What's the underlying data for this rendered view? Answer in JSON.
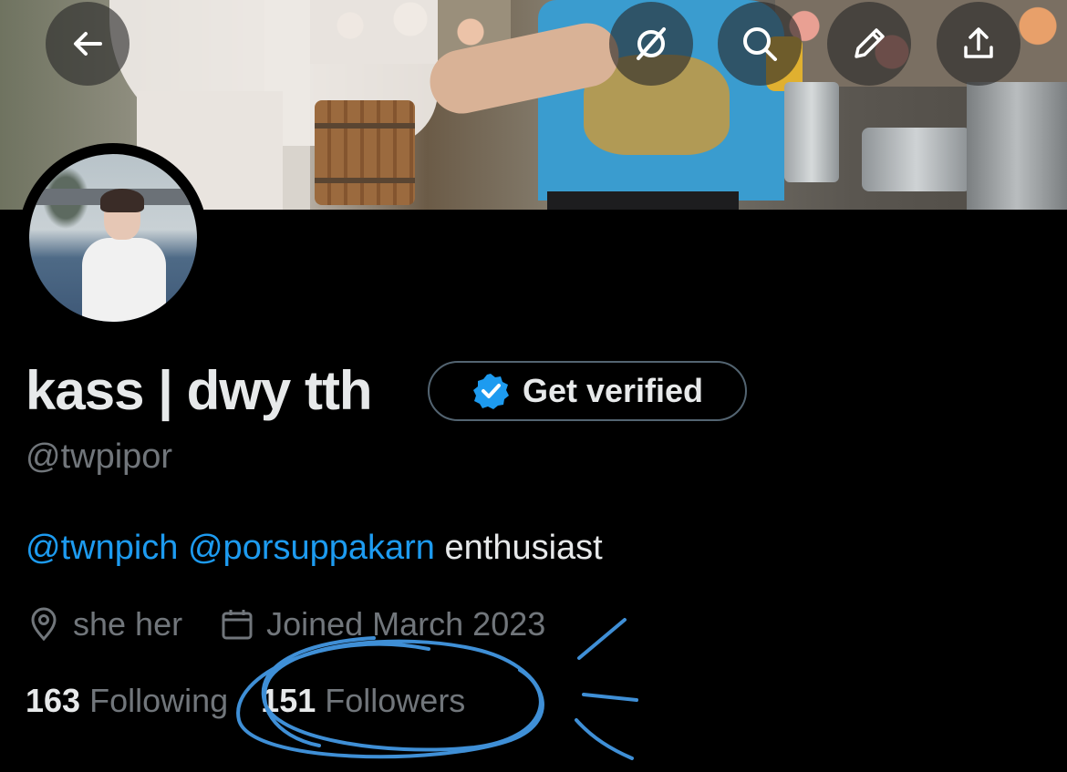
{
  "header": {
    "back_icon": "arrow-left-icon",
    "buttons": [
      {
        "name": "grok-icon"
      },
      {
        "name": "search-icon"
      },
      {
        "name": "edit-pencil-icon"
      },
      {
        "name": "share-upload-icon"
      }
    ]
  },
  "profile": {
    "display_name": "kass | dwy tth",
    "handle": "@twpipor",
    "get_verified_label": "Get verified",
    "bio": {
      "mentions": [
        "@twnpich",
        "@porsuppakarn"
      ],
      "text": "enthusiast"
    },
    "meta": {
      "location": "she her",
      "joined": "Joined March 2023"
    },
    "stats": {
      "following_count": "163",
      "following_label": "Following",
      "followers_count": "151",
      "followers_label": "Followers"
    }
  },
  "colors": {
    "accent": "#1d9bf0",
    "secondary_text": "#71767b",
    "primary_text": "#e7e9ea",
    "background": "#000000",
    "annotation": "#3f8fd6"
  }
}
